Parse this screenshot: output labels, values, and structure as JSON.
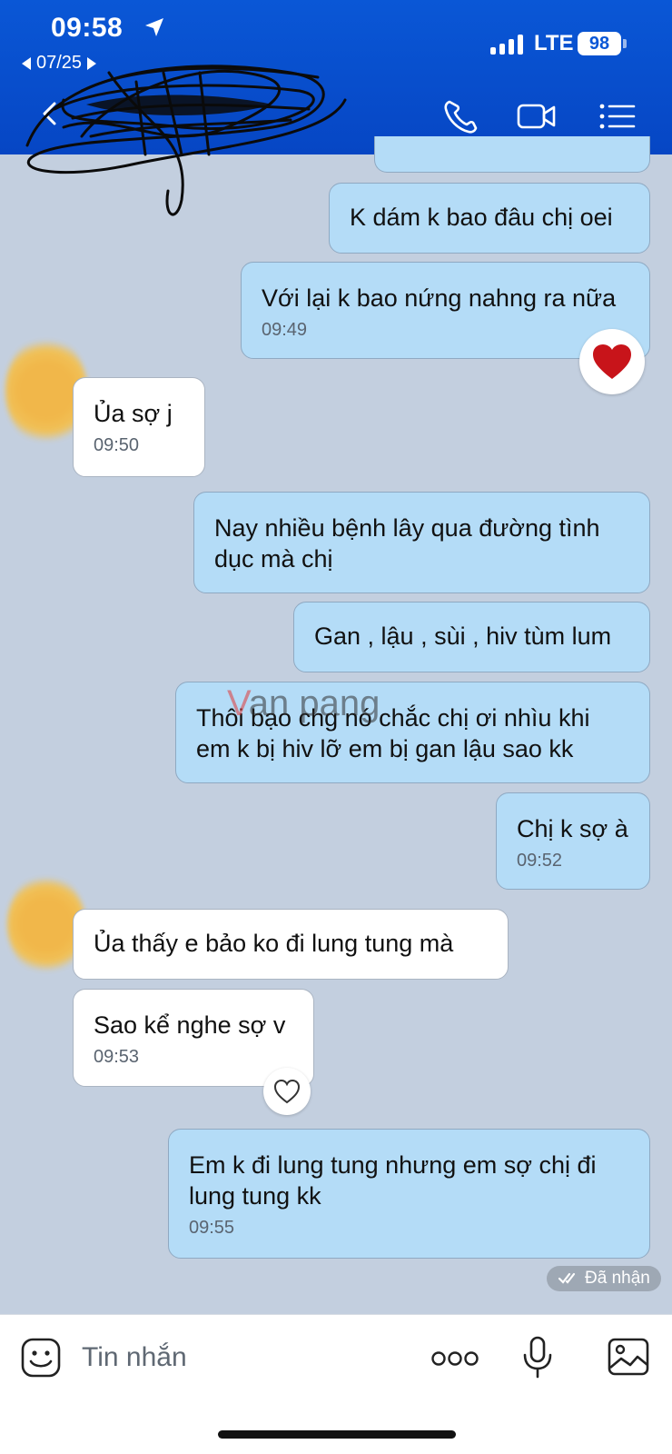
{
  "status_bar": {
    "time": "09:58",
    "date": "07/25",
    "network": "LTE",
    "battery": "98"
  },
  "header": {
    "contact_name_redacted": true
  },
  "messages": [
    {
      "text": "K dám k bao đâu chị oei"
    },
    {
      "text": "Với lại k bao nứng nahng ra nữa",
      "time": "09:49",
      "reaction": "heart-filled"
    },
    {
      "text": "Ủa sợ j",
      "time": "09:50"
    },
    {
      "text": "Nay nhiều bệnh lây qua đường tình dục mà chị"
    },
    {
      "text": "Gan , lậu , sùi , hiv tùm lum"
    },
    {
      "text": "Thôi bạo chg nó chắc chị ơi  nhìu khi em k bị hiv lỡ em bị gan lậu sao kk"
    },
    {
      "text": "Chị k sợ à",
      "time": "09:52"
    },
    {
      "text": "Ủa thấy e bảo ko đi lung tung mà"
    },
    {
      "text": "Sao kể nghe sợ v",
      "time": "09:53",
      "reaction": "heart-outline"
    },
    {
      "text": "Em k đi lung tung nhưng em sợ chị đi lung tung kk",
      "time": "09:55"
    }
  ],
  "watermark": {
    "prefix": "V",
    "rest": "an pang"
  },
  "status": {
    "received": "Đã nhận"
  },
  "composer": {
    "placeholder": "Tin nhắn"
  },
  "colors": {
    "header": "#0a57d6",
    "background": "#c3cfdf",
    "outgoing": "#b4dcf7",
    "incoming": "#ffffff"
  }
}
